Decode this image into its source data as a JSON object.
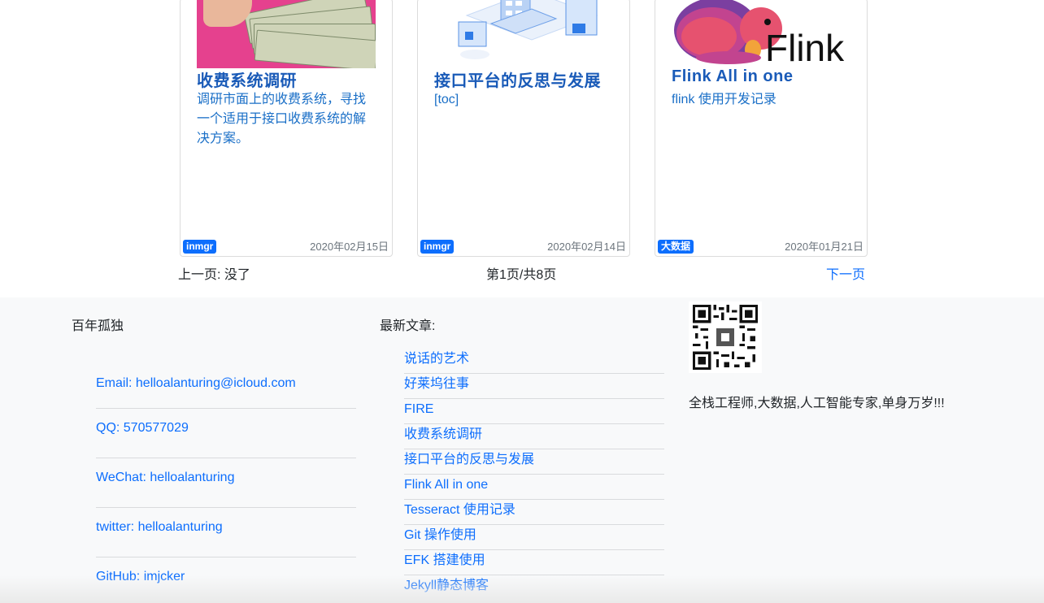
{
  "cards": [
    {
      "title": "收费系统调研",
      "desc": "调研市面上的收费系统，寻找一个适用于接口收费系统的解决方案。",
      "tag": "inmgr",
      "date": "2020年02月15日"
    },
    {
      "title": "接口平台的反思与发展",
      "desc": "[toc]",
      "tag": "inmgr",
      "date": "2020年02月14日"
    },
    {
      "title": "Flink All in one",
      "desc": "flink 使用开发记录",
      "tag": "大数据",
      "date": "2020年01月21日",
      "logo_text": "Flink"
    }
  ],
  "pagination": {
    "prev": "上一页: 没了",
    "info": "第1页/共8页",
    "next": "下一页"
  },
  "footer": {
    "site_name": "百年孤独",
    "contacts": [
      "Email: helloalanturing@icloud.com",
      "QQ: 570577029",
      "WeChat: helloalanturing",
      "twitter: helloalanturing",
      "GitHub: imjcker"
    ],
    "latest_title": "最新文章:",
    "latest_articles": [
      "说话的艺术",
      "好莱坞往事",
      "FIRE",
      "收费系统调研",
      "接口平台的反思与发展",
      "Flink All in one",
      "Tesseract 使用记录",
      "Git 操作使用",
      "EFK 搭建使用",
      "Jekyll静态博客"
    ],
    "bio": "全栈工程师,大数据,人工智能专家,单身万岁!!!"
  },
  "colors": {
    "link": "#0d6efd",
    "title": "#1a5bb8",
    "tag_bg": "#0d6efd",
    "footer_bg": "#f8f9fa",
    "money_bg": "#e5418e",
    "flink_pink": "#e6526f"
  }
}
